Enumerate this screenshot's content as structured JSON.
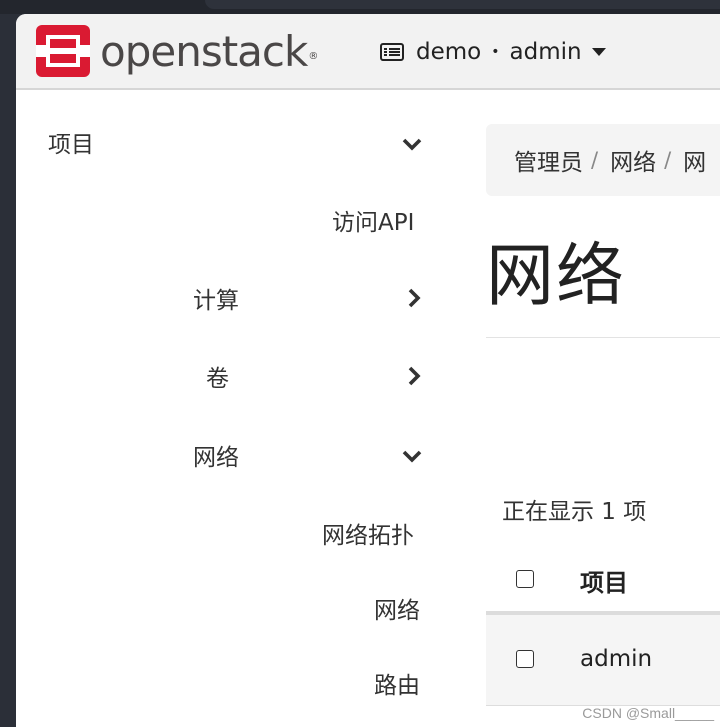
{
  "brand": {
    "name": "openstack",
    "reg_mark": "®"
  },
  "project_switcher": {
    "project": "demo",
    "separator": "•",
    "user": "admin"
  },
  "sidebar": {
    "items": [
      {
        "label": "项目"
      },
      {
        "label": "访问API"
      },
      {
        "label": "计算"
      },
      {
        "label": "卷"
      },
      {
        "label": "网络"
      },
      {
        "label": "网络拓扑"
      },
      {
        "label": "网络"
      },
      {
        "label": "路由"
      }
    ]
  },
  "breadcrumb": {
    "items": [
      "管理员",
      "网络",
      "网"
    ],
    "separator": "/"
  },
  "page": {
    "title": "网络"
  },
  "table": {
    "count_text": "正在显示 1 项",
    "columns": [
      "项目"
    ],
    "rows": [
      {
        "project": "admin"
      }
    ]
  },
  "watermark": "CSDN @Small_____",
  "colors": {
    "brand_red": "#da1a32",
    "navbar_bg": "#f2f2f2",
    "page_bg": "#ffffff"
  }
}
